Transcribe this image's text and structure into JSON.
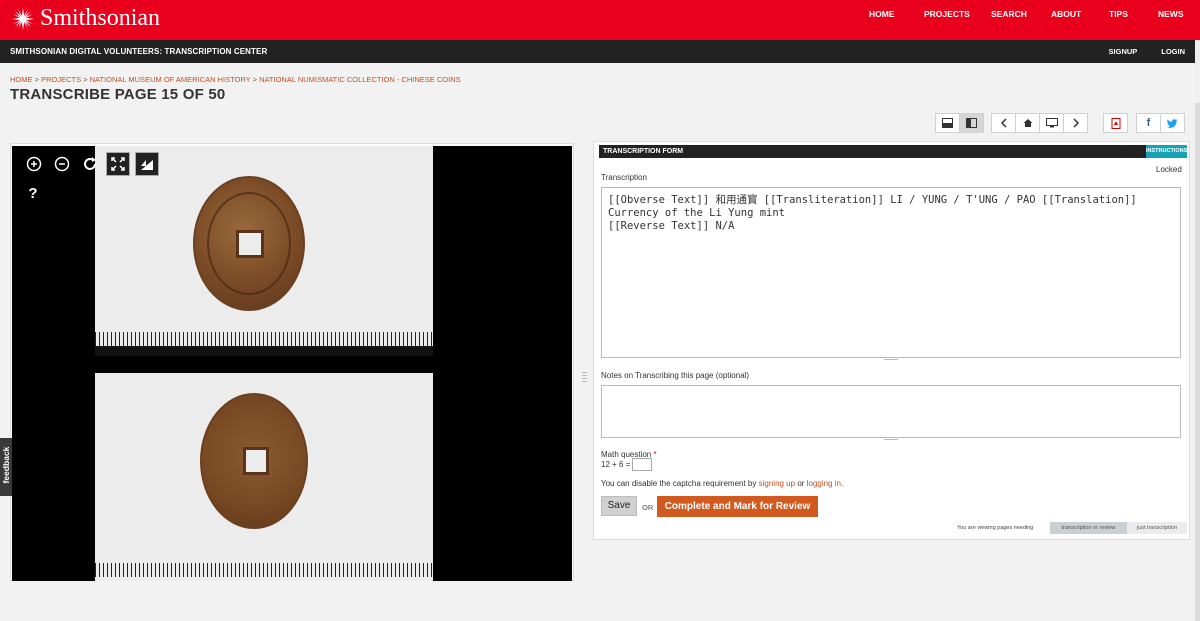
{
  "brand": {
    "name": "Smithsonian",
    "color": "#e8001c"
  },
  "nav": {
    "items": [
      "HOME",
      "PROJECTS",
      "SEARCH",
      "ABOUT",
      "TIPS",
      "NEWS"
    ]
  },
  "subbar": {
    "title": "SMITHSONIAN DIGITAL VOLUNTEERS: TRANSCRIPTION CENTER",
    "signup": "SIGNUP",
    "login": "LOGIN"
  },
  "breadcrumb": [
    "HOME",
    "PROJECTS",
    "NATIONAL MUSEUM OF AMERICAN HISTORY",
    "NATIONAL NUMISMATIC COLLECTION - CHINESE COINS"
  ],
  "page_title": "TRANSCRIBE PAGE 15 OF 50",
  "toolbar_icons": [
    "layout-horizontal-icon",
    "layout-vertical-icon",
    "previous-icon",
    "home-icon",
    "slideshow-icon",
    "next-icon",
    "pdf-icon",
    "facebook-icon",
    "twitter-icon"
  ],
  "viewer": {
    "controls": {
      "help": "?"
    }
  },
  "feedback": "feedback",
  "form": {
    "header": "TRANSCRIPTION FORM",
    "instructions": "INSTRUCTIONS",
    "transcription_label": "Transcription",
    "locked": "Locked",
    "transcription_value": "[[Obverse Text]] 和用通寳 [[Transliteration]] LI / YUNG / T'UNG / PAO [[Translation]]\nCurrency of the Li Yung mint\n[[Reverse Text]] N/A",
    "notes_label": "Notes on Transcribing this page (optional)",
    "notes_value": "",
    "math_label": "Math question",
    "math_required": "*",
    "math_question": "12 + 6 =",
    "captcha_text_before": "You can disable the captcha requirement by",
    "captcha_link_signup": "signing up",
    "captcha_text_or": "or",
    "captcha_link_login": "logging in",
    "captcha_text_after": ".",
    "save": "Save",
    "or": "OR",
    "complete": "Complete and Mark for Review",
    "viewing_text": "You are viewing pages needing",
    "view_tags": [
      "transcription or review",
      "just transcription"
    ],
    "accent_color": "#d35a1e",
    "instructions_color": "#17a3b5"
  }
}
